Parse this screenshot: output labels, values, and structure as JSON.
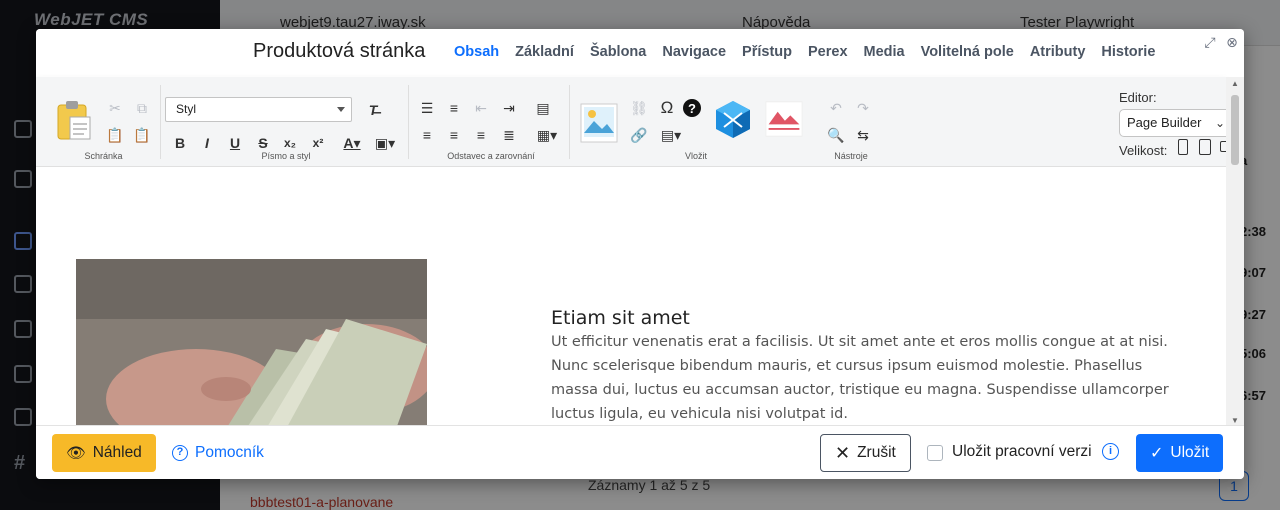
{
  "background": {
    "logo": "WebJET CMS",
    "domain": "webjet9.tau27.iway.sk",
    "help": "Nápověda",
    "user": "Tester Playwright",
    "times": [
      "a",
      "2:38",
      "9:07",
      "9:27",
      "5:06",
      "6:57"
    ],
    "records": "Záznamy 1 až 5 z 5",
    "tree_item": "bbbtest01-a-planovane",
    "page_number": "1"
  },
  "modal": {
    "title": "Produktová stránka",
    "tabs": [
      "Obsah",
      "Základní",
      "Šablona",
      "Navigace",
      "Přístup",
      "Perex",
      "Media",
      "Volitelná pole",
      "Atributy",
      "Historie"
    ],
    "active_tab": "Obsah"
  },
  "toolbar": {
    "groups": {
      "clipboard": "Schránka",
      "font": "Písmo a styl",
      "paragraph": "Odstavec a zarovnání",
      "insert": "Vložit",
      "tools": "Nástroje"
    },
    "style_select": "Styl",
    "editor_label": "Editor:",
    "editor_value": "Page Builder",
    "size_label": "Velikost:"
  },
  "content": {
    "heading": "Etiam sit amet",
    "body": "Ut efficitur venenatis erat a facilisis. Ut sit amet ante et eros mollis congue at at nisi. Nunc scelerisque bibendum mauris, et cursus ipsum euismod molestie. Phasellus massa dui, luctus eu accumsan auctor, tristique eu magna. Suspendisse ullamcorper luctus ligula, eu vehicula nisi volutpat id."
  },
  "footer": {
    "preview": "Náhled",
    "help": "Pomocník",
    "cancel": "Zrušit",
    "save_draft": "Uložit pracovní verzi",
    "save": "Uložit"
  },
  "colors": {
    "accent": "#0d6efd",
    "preview_button": "#f7b928",
    "sidebar": "#15171c"
  }
}
